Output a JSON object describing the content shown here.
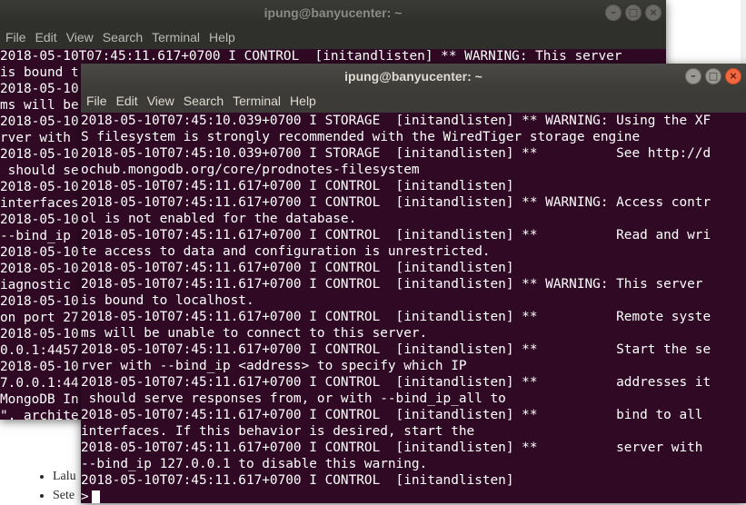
{
  "background_page": {
    "list": [
      "Lalu",
      "Sete"
    ]
  },
  "back_terminal": {
    "title": "ipung@banyucenter: ~",
    "menu": [
      "File",
      "Edit",
      "View",
      "Search",
      "Terminal",
      "Help"
    ],
    "lines": [
      "2018-05-10T07:45:11.617+0700 I CONTROL  [initandlisten] ** WARNING: This server",
      "is bound t",
      "2018-05-10",
      "ms will be",
      "2018-05-10",
      "rver with ",
      "2018-05-10",
      " should se",
      "2018-05-10",
      "interfaces",
      "2018-05-10",
      "--bind_ip ",
      "2018-05-10",
      "2018-05-10",
      "iagnostic ",
      "2018-05-10",
      "on port 27",
      "2018-05-10",
      "0.0.1:4457",
      "2018-05-10",
      "7.0.0.1:44",
      "MongoDB In",
      "\", archite"
    ]
  },
  "front_terminal": {
    "title": "ipung@banyucenter: ~",
    "menu": [
      "File",
      "Edit",
      "View",
      "Search",
      "Terminal",
      "Help"
    ],
    "lines": [
      "2018-05-10T07:45:10.039+0700 I STORAGE  [initandlisten] ** WARNING: Using the XF",
      "S filesystem is strongly recommended with the WiredTiger storage engine",
      "2018-05-10T07:45:10.039+0700 I STORAGE  [initandlisten] **          See http://d",
      "ochub.mongodb.org/core/prodnotes-filesystem",
      "2018-05-10T07:45:11.617+0700 I CONTROL  [initandlisten]",
      "2018-05-10T07:45:11.617+0700 I CONTROL  [initandlisten] ** WARNING: Access contr",
      "ol is not enabled for the database.",
      "2018-05-10T07:45:11.617+0700 I CONTROL  [initandlisten] **          Read and wri",
      "te access to data and configuration is unrestricted.",
      "2018-05-10T07:45:11.617+0700 I CONTROL  [initandlisten]",
      "2018-05-10T07:45:11.617+0700 I CONTROL  [initandlisten] ** WARNING: This server",
      "is bound to localhost.",
      "2018-05-10T07:45:11.617+0700 I CONTROL  [initandlisten] **          Remote syste",
      "ms will be unable to connect to this server.",
      "2018-05-10T07:45:11.617+0700 I CONTROL  [initandlisten] **          Start the se",
      "rver with --bind_ip <address> to specify which IP",
      "2018-05-10T07:45:11.617+0700 I CONTROL  [initandlisten] **          addresses it",
      " should serve responses from, or with --bind_ip_all to",
      "2018-05-10T07:45:11.617+0700 I CONTROL  [initandlisten] **          bind to all",
      "interfaces. If this behavior is desired, start the",
      "2018-05-10T07:45:11.617+0700 I CONTROL  [initandlisten] **          server with",
      "--bind_ip 127.0.0.1 to disable this warning.",
      "2018-05-10T07:45:11.617+0700 I CONTROL  [initandlisten]"
    ],
    "prompt": ">"
  },
  "icons": {
    "minimize": "minimize-icon",
    "maximize": "maximize-icon",
    "close": "close-icon"
  },
  "colors": {
    "terminal_bg": "#300a24",
    "titlebar_active": "#3c3b37",
    "close_button": "#f16840",
    "scrollbar_thumb": "#e64a19"
  }
}
